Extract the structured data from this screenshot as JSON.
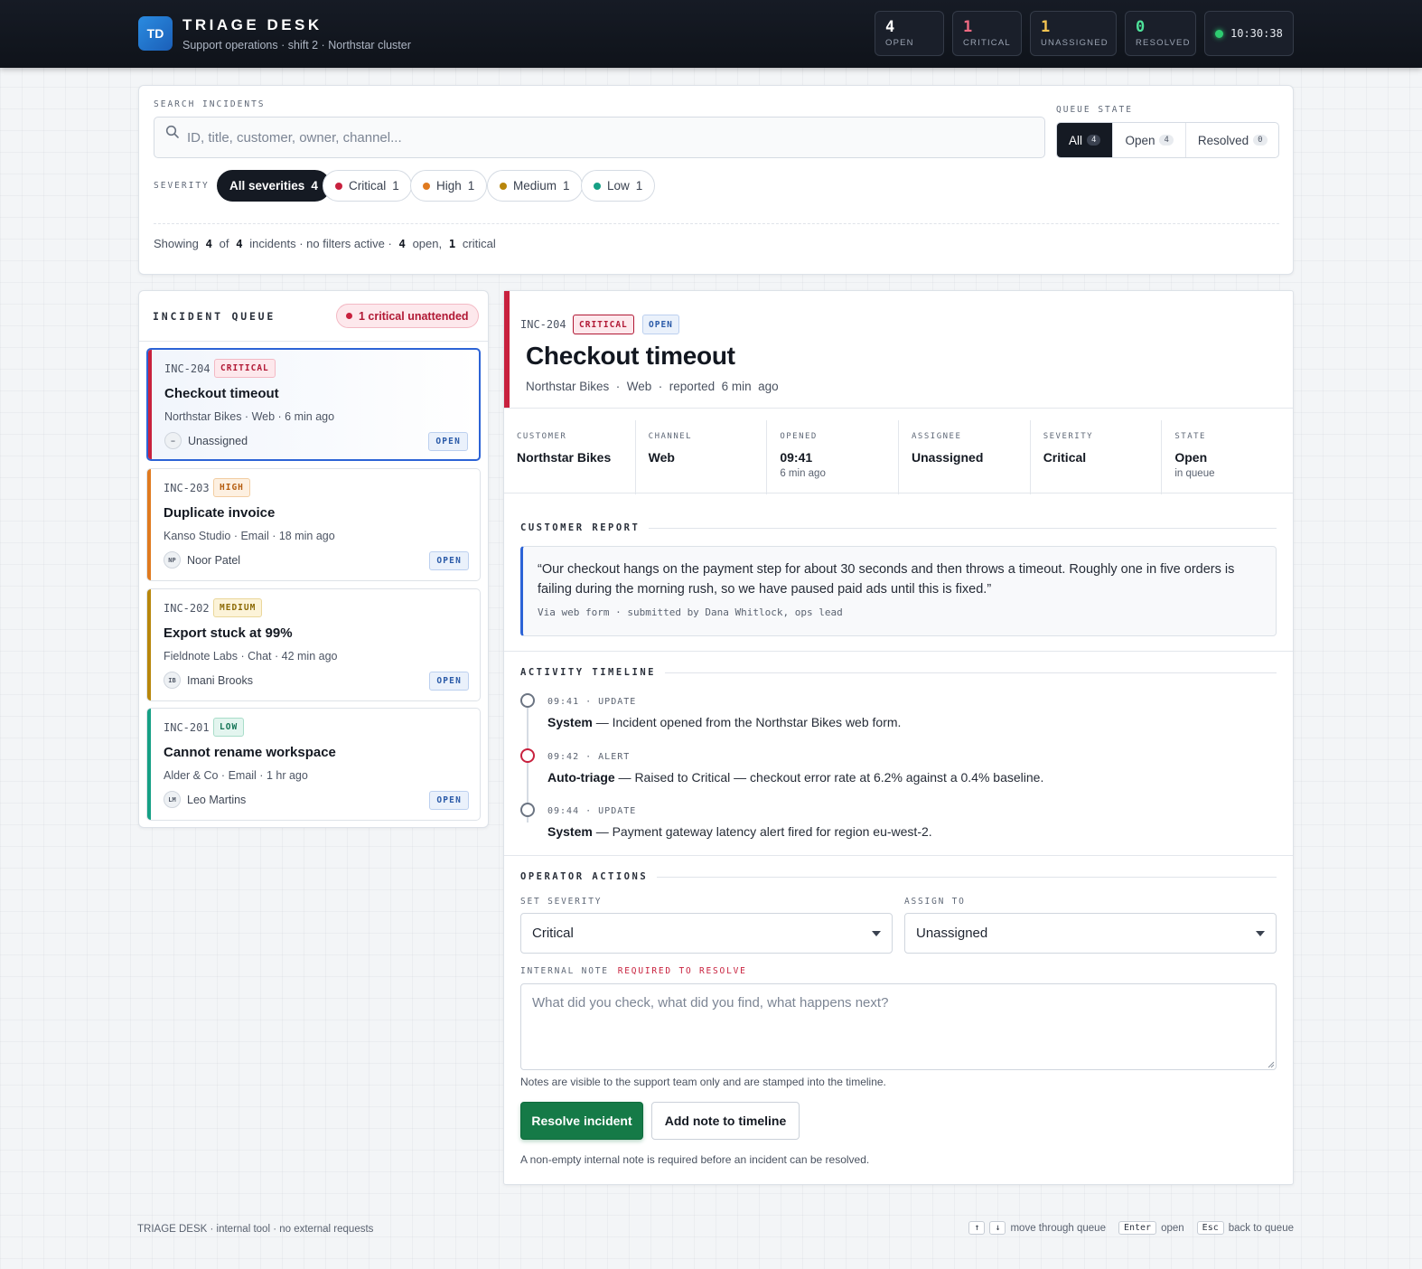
{
  "brand": {
    "logo": "TD",
    "title": "TRIAGE DESK",
    "subtitle": "Support operations · shift 2 · Northstar cluster"
  },
  "stats": [
    {
      "value": "4",
      "label": "OPEN",
      "color": "#ffffff"
    },
    {
      "value": "1",
      "label": "CRITICAL",
      "color": "#f06a82"
    },
    {
      "value": "1",
      "label": "UNASSIGNED",
      "color": "#f5c451"
    },
    {
      "value": "0",
      "label": "RESOLVED",
      "color": "#4ee29a"
    }
  ],
  "clock": "10:30:38",
  "search": {
    "label": "SEARCH INCIDENTS",
    "placeholder": "ID, title, customer, owner, channel..."
  },
  "queue_state": {
    "label": "QUEUE STATE",
    "options": [
      {
        "label": "All",
        "count": "4"
      },
      {
        "label": "Open",
        "count": "4"
      },
      {
        "label": "Resolved",
        "count": "0"
      }
    ]
  },
  "severity_filter": {
    "label": "SEVERITY",
    "chips": [
      {
        "label": "All severities",
        "count": "4"
      },
      {
        "label": "Critical",
        "count": "1",
        "color": "#c8213e"
      },
      {
        "label": "High",
        "count": "1",
        "color": "#e07a1f"
      },
      {
        "label": "Medium",
        "count": "1",
        "color": "#b8860b"
      },
      {
        "label": "Low",
        "count": "1",
        "color": "#16a085"
      }
    ]
  },
  "summary": {
    "showing": "Showing",
    "shown": "4",
    "of": "of",
    "total": "4",
    "incidents": "incidents · no filters active ·",
    "open_count": "4",
    "open_label": "open,",
    "critical_count": "1",
    "critical_label": "critical"
  },
  "queue": {
    "title": "INCIDENT QUEUE",
    "alert": "1 critical unattended",
    "items": [
      {
        "id": "INC-204",
        "severity": "CRITICAL",
        "title": "Checkout timeout",
        "customer": "Northstar Bikes",
        "channel": "Web",
        "age": "6 min ago",
        "owner": "Unassigned",
        "initials": "–",
        "state": "OPEN"
      },
      {
        "id": "INC-203",
        "severity": "HIGH",
        "title": "Duplicate invoice",
        "customer": "Kanso Studio",
        "channel": "Email",
        "age": "18 min ago",
        "owner": "Noor Patel",
        "initials": "NP",
        "state": "OPEN"
      },
      {
        "id": "INC-202",
        "severity": "MEDIUM",
        "title": "Export stuck at 99%",
        "customer": "Fieldnote Labs",
        "channel": "Chat",
        "age": "42 min ago",
        "owner": "Imani Brooks",
        "initials": "IB",
        "state": "OPEN"
      },
      {
        "id": "INC-201",
        "severity": "LOW",
        "title": "Cannot rename workspace",
        "customer": "Alder & Co",
        "channel": "Email",
        "age": "1 hr ago",
        "owner": "Leo Martins",
        "initials": "LM",
        "state": "OPEN"
      }
    ]
  },
  "detail": {
    "id": "INC-204",
    "severity_badge": "CRITICAL",
    "state_badge": "OPEN",
    "title": "Checkout timeout",
    "subtitle": {
      "customer": "Northstar Bikes",
      "channel": "Web",
      "reported": "reported",
      "age_num": "6 min",
      "age_word": "ago"
    },
    "facts": [
      {
        "key": "CUSTOMER",
        "value": "Northstar Bikes",
        "sub": ""
      },
      {
        "key": "CHANNEL",
        "value": "Web",
        "sub": ""
      },
      {
        "key": "OPENED",
        "value": "09:41",
        "sub": "6 min ago"
      },
      {
        "key": "ASSIGNEE",
        "value": "Unassigned",
        "sub": ""
      },
      {
        "key": "SEVERITY",
        "value": "Critical",
        "sub": ""
      },
      {
        "key": "STATE",
        "value": "Open",
        "sub": "in queue"
      }
    ],
    "report_title": "CUSTOMER REPORT",
    "report_text": "“Our checkout hangs on the payment step for about 30 seconds and then throws a timeout. Roughly one in five orders is failing during the morning rush, so we have paused paid ads until this is fixed.”",
    "report_via": "Via web form · submitted by Dana Whitlock, ops lead",
    "timeline_title": "ACTIVITY TIMELINE",
    "timeline": [
      {
        "time": "09:41 · UPDATE",
        "actor": "System",
        "text": " — Incident opened from the Northstar Bikes web form."
      },
      {
        "time": "09:42 · ALERT",
        "actor": "Auto-triage",
        "text": " — Raised to Critical — checkout error rate at 6.2% against a 0.4% baseline."
      },
      {
        "time": "09:44 · UPDATE",
        "actor": "System",
        "text": " — Payment gateway latency alert fired for region eu-west-2."
      }
    ],
    "actions_title": "OPERATOR ACTIONS",
    "set_severity_label": "SET SEVERITY",
    "set_severity_value": "Critical",
    "assign_label": "ASSIGN TO",
    "assign_value": "Unassigned",
    "note_label": "INTERNAL NOTE",
    "note_required": "REQUIRED TO RESOLVE",
    "note_placeholder": "What did you check, what did you find, what happens next?",
    "note_hint": "Notes are visible to the support team only and are stamped into the timeline.",
    "resolve_label": "Resolve incident",
    "add_note_label": "Add note to timeline",
    "resolve_hint": "A non-empty internal note is required before an incident can be resolved."
  },
  "footer": {
    "left": "TRIAGE DESK · internal tool · no external requests",
    "up_key": "↑",
    "down_key": "↓",
    "move_label": "move through queue",
    "enter_key": "Enter",
    "open_label": "open",
    "esc_key": "Esc",
    "back_label": "back to queue"
  }
}
